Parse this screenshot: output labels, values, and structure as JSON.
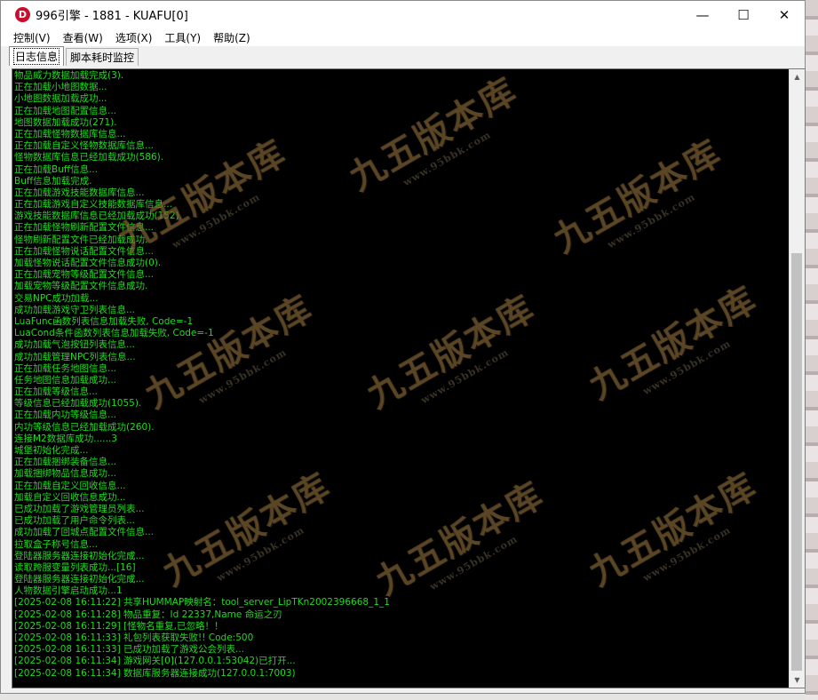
{
  "window": {
    "title": "996引擎 - 1881 - KUAFU[0]",
    "icon_letter": "D"
  },
  "controls": {
    "minimize": "—",
    "maximize": "☐",
    "close": "✕"
  },
  "menu": [
    "控制(V)",
    "查看(W)",
    "选项(X)",
    "工具(Y)",
    "帮助(Z)"
  ],
  "tabs": [
    "日志信息",
    "脚本耗时监控"
  ],
  "watermark": {
    "main": "九五版本库",
    "sub": "www.95bbk.com"
  },
  "log_lines": [
    "物品威力数据加载完成(3).",
    "正在加载小地图数据...",
    "小地图数据加载成功...",
    "正在加载地图配置信息...",
    "地图数据加载成功(271).",
    "正在加载怪物数据库信息...",
    "正在加载自定义怪物数据库信息...",
    "怪物数据库信息已经加载成功(586).",
    "正在加载Buff信息...",
    "Buff信息加载完成.",
    "正在加载游戏技能数据库信息...",
    "正在加载游戏自定义技能数据库信息...",
    "游戏技能数据库信息已经加载成功(152).",
    "正在加载怪物刷新配置文件信息...",
    "怪物刷新配置文件已经加载成功.",
    "正在加载怪物说话配置文件信息...",
    "加载怪物说话配置文件信息成功(0).",
    "正在加载宠物等级配置文件信息...",
    "加载宠物等级配置文件信息成功.",
    "交易NPC成功加载...",
    "成功加载游戏守卫列表信息...",
    "LuaFunc函数列表信息加载失败, Code=-1",
    "LuaCond条件函数列表信息加载失败, Code=-1",
    "成功加载气泡按钮列表信息...",
    "成功加载管理NPC列表信息...",
    "正在加载任务地图信息...",
    "任务地图信息加载成功...",
    "正在加载等级信息...",
    "等级信息已经加载成功(1055).",
    "正在加载内功等级信息...",
    "内功等级信息已经加载成功(260).",
    "连接M2数据库成功......3",
    "城堡初始化完成...",
    "正在加载捆绑装备信息...",
    "加载捆绑物品信息成功...",
    "正在加载自定义回收信息...",
    "加载自定义回收信息成功...",
    "已成功加载了游戏管理员列表...",
    "已成功加载了用户命令列表...",
    "成功加载了回城点配置文件信息...",
    "拉取盒子称号信息...",
    "登陆器服务器连接初始化完成...",
    "读取跨服变量列表成功...[16]",
    "登陆器服务器连接初始化完成...",
    "人物数据引擎启动成功...1",
    "[2025-02-08 16:11:22] 共享HUMMAP映射名：tool_server_LipTKn2002396668_1_1",
    "[2025-02-08 16:11:28] 物品重复：Id 22337,Name 命运之刃",
    "[2025-02-08 16:11:29] [怪物名重复,已忽略！！",
    "[2025-02-08 16:11:33] 礼包列表获取失败!! Code:500",
    "[2025-02-08 16:11:33] 已成功加载了游戏公会列表...",
    "[2025-02-08 16:11:34] 游戏网关[0](127.0.0.1:53042)已打开...",
    "[2025-02-08 16:11:34] 数据库服务器连接成功(127.0.0.1:7003)"
  ]
}
